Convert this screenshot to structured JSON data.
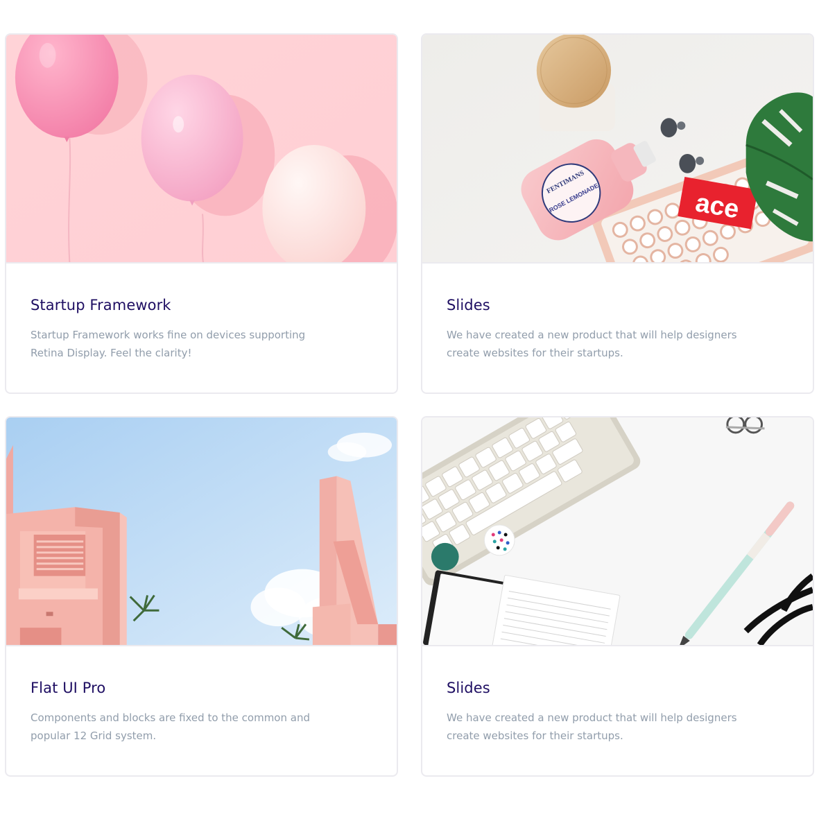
{
  "cards": [
    {
      "title": "Startup Framework",
      "text": "Startup Framework works fine on devices supporting Retina Display. Feel the clarity!",
      "image": "pink-balloons-photo"
    },
    {
      "title": "Slides",
      "text": "We have created a new product that will help designers create websites for their startups.",
      "image": "desk-flatlay-lemonade-keyboard-photo",
      "image_text": {
        "bottle_brand": "FENTIMANS",
        "bottle_label": "ROSE LEMONADE",
        "sticker": "ace"
      }
    },
    {
      "title": "Flat UI Pro",
      "text": "Components and blocks are fixed to the common and popular 12 Grid system.",
      "image": "pink-buildings-blue-sky-photo"
    },
    {
      "title": "Slides",
      "text": "We have created a new product that will help designers create websites for their startups.",
      "image": "white-desk-keyboard-notebook-pen-photo"
    }
  ],
  "colors": {
    "title": "#1e0e62",
    "text": "#919dab",
    "card_border": "#ebeaef"
  }
}
